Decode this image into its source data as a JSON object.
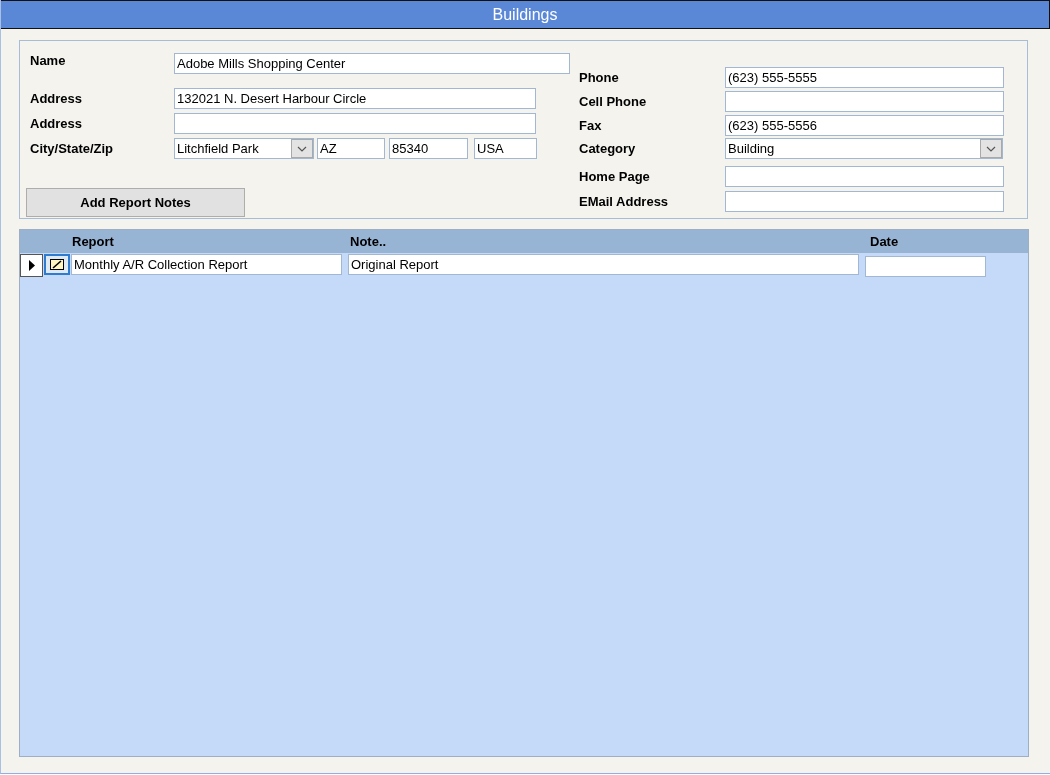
{
  "window": {
    "title": "Buildings"
  },
  "form": {
    "left_fields": [
      {
        "label": "Name",
        "kind": "text",
        "value": "Adobe Mills Shopping Center"
      },
      {
        "label": "Address",
        "kind": "text",
        "value": "132021 N. Desert Harbour Circle"
      },
      {
        "label": "Address",
        "kind": "text"
      },
      {
        "label": "City/State/Zip",
        "kind": "city_state_zip",
        "city": "Litchfield Park",
        "state": "AZ",
        "zip": "85340",
        "country": "USA"
      }
    ],
    "right_fields": [
      {
        "label": "Phone",
        "kind": "text",
        "value": "(623) 555-5555"
      },
      {
        "label": "Cell Phone",
        "kind": "text"
      },
      {
        "label": "Fax",
        "kind": "text",
        "value": "(623) 555-5556"
      },
      {
        "label": "Category",
        "kind": "dropdown",
        "value": "Building"
      },
      {
        "label": "Home Page",
        "kind": "text"
      },
      {
        "label": "EMail Address",
        "kind": "text"
      }
    ],
    "buttons": [
      "Add Report Notes"
    ]
  },
  "report_notes": {
    "columns": [
      "Report",
      "Note..",
      "Date"
    ],
    "rows": [
      {
        "selected": true,
        "report": "Monthly A/R Collection Report",
        "note": "Original Report"
      }
    ]
  }
}
